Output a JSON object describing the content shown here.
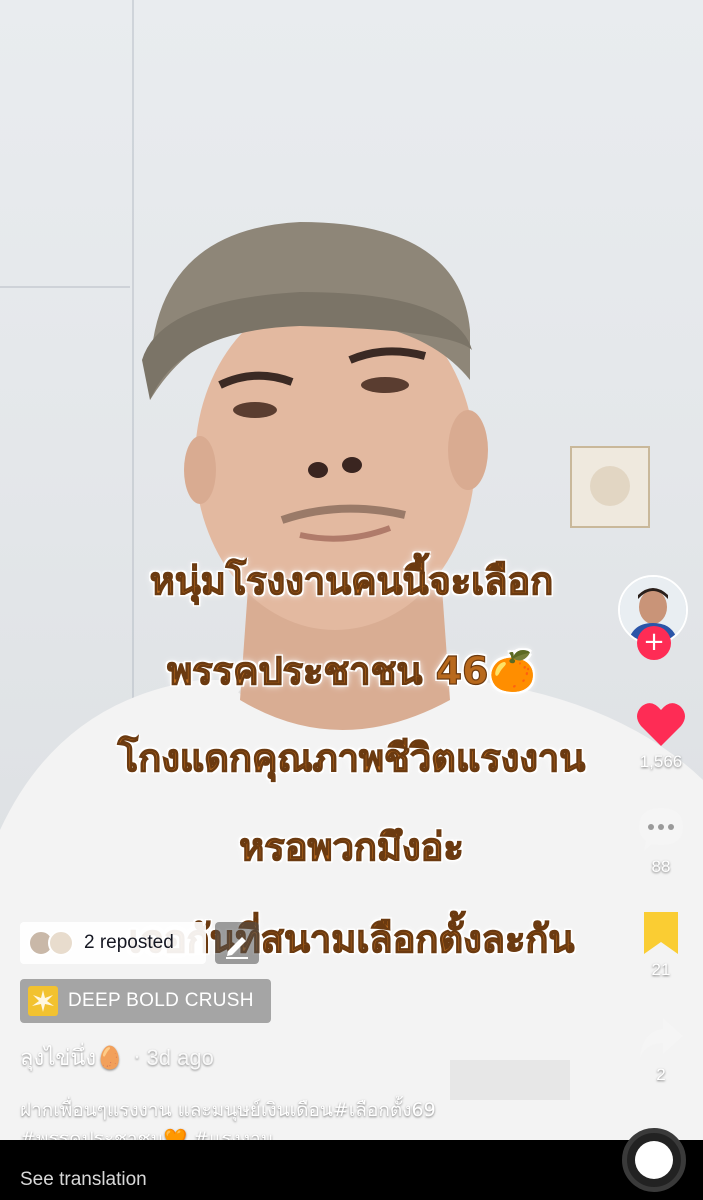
{
  "video": {
    "overlay_lines": [
      "หนุ่มโรงงานคนนี้จะเลือก",
      "พรรคประชาชน 46🍊",
      "โกงแดกคุณภาพชีวิตแรงงาน",
      "หรอพวกมึงอ่ะ",
      "เจอกันที่สนามเลือกตั้งละกัน"
    ]
  },
  "rail": {
    "like_count": "1,566",
    "comment_count": "88",
    "bookmark_count": "21",
    "share_count": "2"
  },
  "repost": {
    "label": "2 reposted"
  },
  "music": {
    "label": "DEEP BOLD CRUSH"
  },
  "author": {
    "name": "ลุงไข่นึ่ง🥚",
    "separator": "·",
    "time": "3d ago"
  },
  "caption": {
    "line1": "ฝากเพื่อนๆแรงงาน และมนุษย์เงินเดือน#เลือกตั้ง69",
    "line2": "#พรรคประชาชน🧡 #แรงงาน"
  },
  "see_translation": "See translation",
  "colors": {
    "like": "#fe2c55",
    "bookmark": "#facd33",
    "overlay_text": "#b8691d"
  },
  "icons": [
    "plus-icon",
    "heart-icon",
    "comment-icon",
    "bookmark-icon",
    "share-icon",
    "pencil-icon",
    "music-icon"
  ]
}
